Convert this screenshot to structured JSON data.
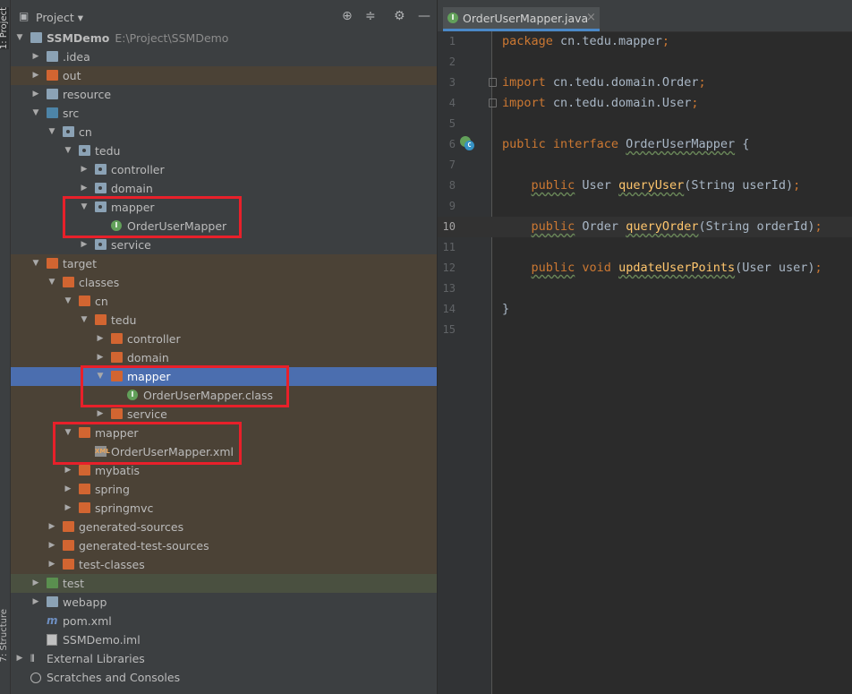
{
  "sidebar": {
    "project_tab": "1: Project",
    "structure_tab": "7: Structure"
  },
  "panel": {
    "title": "Project",
    "icons": [
      "crosshair-icon",
      "collapse-icon",
      "gear-icon",
      "minimize-icon"
    ]
  },
  "tree": [
    {
      "label": "SSMDemo",
      "path": "E:\\Project\\SSMDemo",
      "depth": 0,
      "arrow": "▼",
      "icon": "module",
      "bold": true
    },
    {
      "label": ".idea",
      "depth": 1,
      "arrow": "▶",
      "icon": "plain"
    },
    {
      "label": "out",
      "depth": 1,
      "arrow": "▶",
      "icon": "excl",
      "row": "excl"
    },
    {
      "label": "resource",
      "depth": 1,
      "arrow": "▶",
      "icon": "res"
    },
    {
      "label": "src",
      "depth": 1,
      "arrow": "▼",
      "icon": "src"
    },
    {
      "label": "cn",
      "depth": 2,
      "arrow": "▼",
      "icon": "pkg"
    },
    {
      "label": "tedu",
      "depth": 3,
      "arrow": "▼",
      "icon": "pkg"
    },
    {
      "label": "controller",
      "depth": 4,
      "arrow": "▶",
      "icon": "pkg"
    },
    {
      "label": "domain",
      "depth": 4,
      "arrow": "▶",
      "icon": "pkg"
    },
    {
      "label": "mapper",
      "depth": 4,
      "arrow": "▼",
      "icon": "pkg"
    },
    {
      "label": "OrderUserMapper",
      "depth": 5,
      "arrow": "",
      "icon": "interface"
    },
    {
      "label": "service",
      "depth": 4,
      "arrow": "▶",
      "icon": "pkg"
    },
    {
      "label": "target",
      "depth": 1,
      "arrow": "▼",
      "icon": "excl",
      "row": "excl"
    },
    {
      "label": "classes",
      "depth": 2,
      "arrow": "▼",
      "icon": "excl",
      "row": "excl"
    },
    {
      "label": "cn",
      "depth": 3,
      "arrow": "▼",
      "icon": "excl",
      "row": "excl"
    },
    {
      "label": "tedu",
      "depth": 4,
      "arrow": "▼",
      "icon": "excl",
      "row": "excl"
    },
    {
      "label": "controller",
      "depth": 5,
      "arrow": "▶",
      "icon": "excl",
      "row": "excl"
    },
    {
      "label": "domain",
      "depth": 5,
      "arrow": "▶",
      "icon": "excl",
      "row": "excl"
    },
    {
      "label": "mapper",
      "depth": 5,
      "arrow": "▼",
      "icon": "excl",
      "row": "sel"
    },
    {
      "label": "OrderUserMapper.class",
      "depth": 6,
      "arrow": "",
      "icon": "interface",
      "row": "excl"
    },
    {
      "label": "service",
      "depth": 5,
      "arrow": "▶",
      "icon": "excl",
      "row": "excl"
    },
    {
      "label": "mapper",
      "depth": 3,
      "arrow": "▼",
      "icon": "excl",
      "row": "excl"
    },
    {
      "label": "OrderUserMapper.xml",
      "depth": 4,
      "arrow": "",
      "icon": "xml",
      "row": "excl"
    },
    {
      "label": "mybatis",
      "depth": 3,
      "arrow": "▶",
      "icon": "excl",
      "row": "excl"
    },
    {
      "label": "spring",
      "depth": 3,
      "arrow": "▶",
      "icon": "excl",
      "row": "excl"
    },
    {
      "label": "springmvc",
      "depth": 3,
      "arrow": "▶",
      "icon": "excl",
      "row": "excl"
    },
    {
      "label": "generated-sources",
      "depth": 2,
      "arrow": "▶",
      "icon": "excl",
      "row": "excl"
    },
    {
      "label": "generated-test-sources",
      "depth": 2,
      "arrow": "▶",
      "icon": "excl",
      "row": "excl"
    },
    {
      "label": "test-classes",
      "depth": 2,
      "arrow": "▶",
      "icon": "excl",
      "row": "excl"
    },
    {
      "label": "test",
      "depth": 1,
      "arrow": "▶",
      "icon": "test",
      "row": "test"
    },
    {
      "label": "webapp",
      "depth": 1,
      "arrow": "▶",
      "icon": "plain"
    },
    {
      "label": "pom.xml",
      "depth": 1,
      "arrow": "",
      "icon": "maven"
    },
    {
      "label": "SSMDemo.iml",
      "depth": 1,
      "arrow": "",
      "icon": "iml"
    },
    {
      "label": "External Libraries",
      "depth": 0,
      "arrow": "▶",
      "icon": "lib"
    },
    {
      "label": "Scratches and Consoles",
      "depth": 0,
      "arrow": "",
      "icon": "scratch"
    }
  ],
  "editor": {
    "tab_label": "OrderUserMapper.java",
    "close_glyph": "×",
    "active_line": 10,
    "lines": [
      {
        "n": "1",
        "tokens": [
          [
            "kw",
            "package "
          ],
          [
            "pl",
            "cn.tedu.mapper"
          ],
          [
            "kw",
            ";"
          ]
        ]
      },
      {
        "n": "2",
        "tokens": []
      },
      {
        "n": "3",
        "tokens": [
          [
            "kw",
            "import "
          ],
          [
            "pl",
            "cn.tedu.domain.Order"
          ],
          [
            "kw",
            ";"
          ]
        ],
        "fold": true
      },
      {
        "n": "4",
        "tokens": [
          [
            "kw",
            "import "
          ],
          [
            "pl",
            "cn.tedu.domain.User"
          ],
          [
            "kw",
            ";"
          ]
        ],
        "fold": true
      },
      {
        "n": "5",
        "tokens": []
      },
      {
        "n": "6",
        "tokens": [
          [
            "kw",
            "public interface "
          ],
          [
            "pl ul",
            "OrderUserMapper"
          ],
          [
            "pl",
            " {"
          ]
        ],
        "impl": true
      },
      {
        "n": "7",
        "tokens": []
      },
      {
        "n": "8",
        "tokens": [
          [
            "pl",
            "    "
          ],
          [
            "kw ul",
            "public"
          ],
          [
            "pl",
            " User "
          ],
          [
            "fn ul",
            "queryUser"
          ],
          [
            "pl",
            "(String userId)"
          ],
          [
            "kw",
            ";"
          ]
        ]
      },
      {
        "n": "9",
        "tokens": []
      },
      {
        "n": "10",
        "tokens": [
          [
            "pl",
            "    "
          ],
          [
            "kw ul",
            "public"
          ],
          [
            "pl",
            " Order "
          ],
          [
            "fn ul",
            "queryOrder"
          ],
          [
            "pl",
            "(String orderId)"
          ],
          [
            "kw",
            ";"
          ]
        ]
      },
      {
        "n": "11",
        "tokens": []
      },
      {
        "n": "12",
        "tokens": [
          [
            "pl",
            "    "
          ],
          [
            "kw ul",
            "public"
          ],
          [
            "kw",
            " void "
          ],
          [
            "fn ul",
            "updateUserPoints"
          ],
          [
            "pl",
            "(User user)"
          ],
          [
            "kw",
            ";"
          ]
        ]
      },
      {
        "n": "13",
        "tokens": []
      },
      {
        "n": "14",
        "tokens": [
          [
            "pl",
            "}"
          ]
        ]
      },
      {
        "n": "15",
        "tokens": []
      }
    ]
  },
  "colors": {
    "selection": "#4b6eaf",
    "annotation_box": "#e8202a",
    "keyword": "#cc7832",
    "method": "#ffc66d"
  }
}
